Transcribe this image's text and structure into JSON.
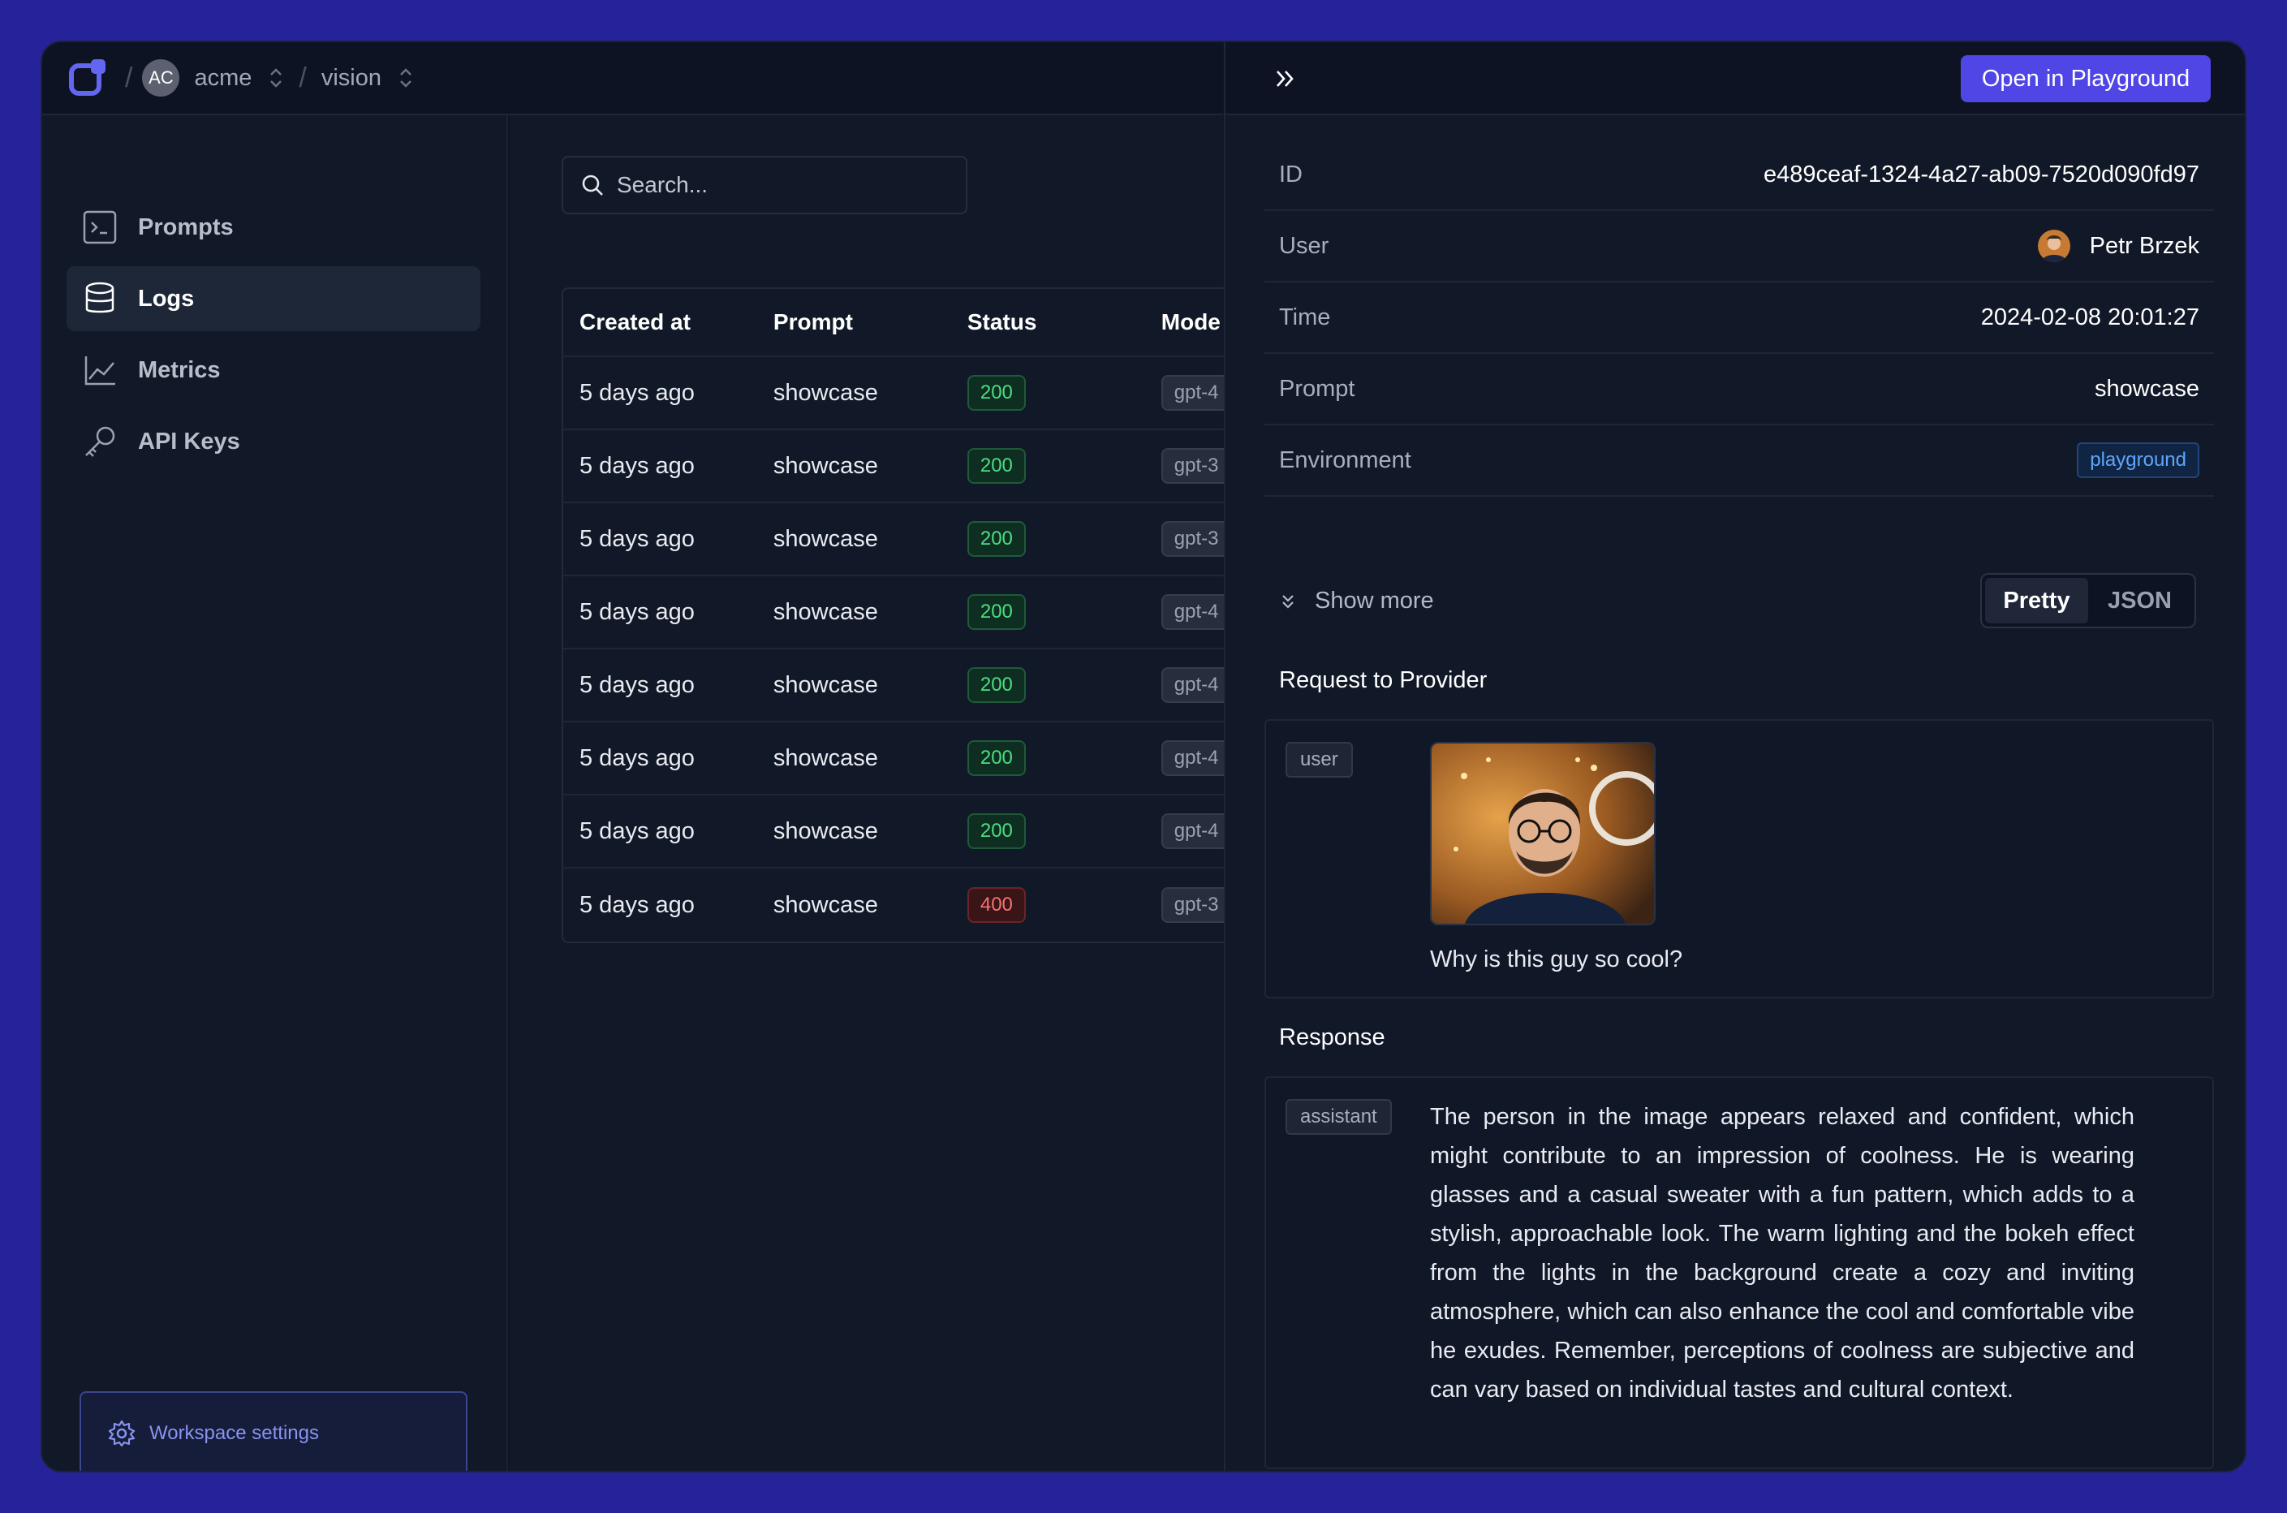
{
  "breadcrumb": {
    "org_initials": "AC",
    "org_name": "acme",
    "project_name": "vision",
    "separator": "/"
  },
  "sidebar": {
    "items": [
      {
        "label": "Prompts",
        "icon": "terminal-icon"
      },
      {
        "label": "Logs",
        "icon": "database-icon",
        "active": true
      },
      {
        "label": "Metrics",
        "icon": "chart-line-icon"
      },
      {
        "label": "API Keys",
        "icon": "key-icon"
      }
    ],
    "workspace_settings": "Workspace settings"
  },
  "logs": {
    "search_placeholder": "Search...",
    "columns": [
      "Created at",
      "Prompt",
      "Status",
      "Mode"
    ],
    "rows": [
      {
        "created": "5 days ago",
        "prompt": "showcase",
        "status": "200",
        "model": "gpt-4"
      },
      {
        "created": "5 days ago",
        "prompt": "showcase",
        "status": "200",
        "model": "gpt-3"
      },
      {
        "created": "5 days ago",
        "prompt": "showcase",
        "status": "200",
        "model": "gpt-3"
      },
      {
        "created": "5 days ago",
        "prompt": "showcase",
        "status": "200",
        "model": "gpt-4"
      },
      {
        "created": "5 days ago",
        "prompt": "showcase",
        "status": "200",
        "model": "gpt-4"
      },
      {
        "created": "5 days ago",
        "prompt": "showcase",
        "status": "200",
        "model": "gpt-4"
      },
      {
        "created": "5 days ago",
        "prompt": "showcase",
        "status": "200",
        "model": "gpt-4"
      },
      {
        "created": "5 days ago",
        "prompt": "showcase",
        "status": "400",
        "model": "gpt-3"
      }
    ]
  },
  "detail": {
    "open_button": "Open in Playground",
    "fields": {
      "id_label": "ID",
      "id_value": "e489ceaf-1324-4a27-ab09-7520d090fd97",
      "user_label": "User",
      "user_value": "Petr Brzek",
      "time_label": "Time",
      "time_value": "2024-02-08 20:01:27",
      "prompt_label": "Prompt",
      "prompt_value": "showcase",
      "env_label": "Environment",
      "env_value": "playground"
    },
    "show_more": "Show more",
    "view_modes": [
      "Pretty",
      "JSON"
    ],
    "request_title": "Request to Provider",
    "request_role": "user",
    "request_text": "Why is this guy so cool?",
    "response_title": "Response",
    "response_role": "assistant",
    "response_text": "The person in the image appears relaxed and confident, which might contribute to an impression of coolness. He is wearing glasses and a casual sweater with a fun pattern, which adds to a stylish, approachable look. The warm lighting and the bokeh effect from the lights in the background create a cozy and inviting atmosphere, which can also enhance the cool and comfortable vibe he exudes. Remember, perceptions of coolness are subjective and can vary based on individual tastes and cultural context."
  },
  "colors": {
    "background": "#25229a",
    "accent": "#4f46e5",
    "success": "#4ade80",
    "error": "#f87171"
  }
}
